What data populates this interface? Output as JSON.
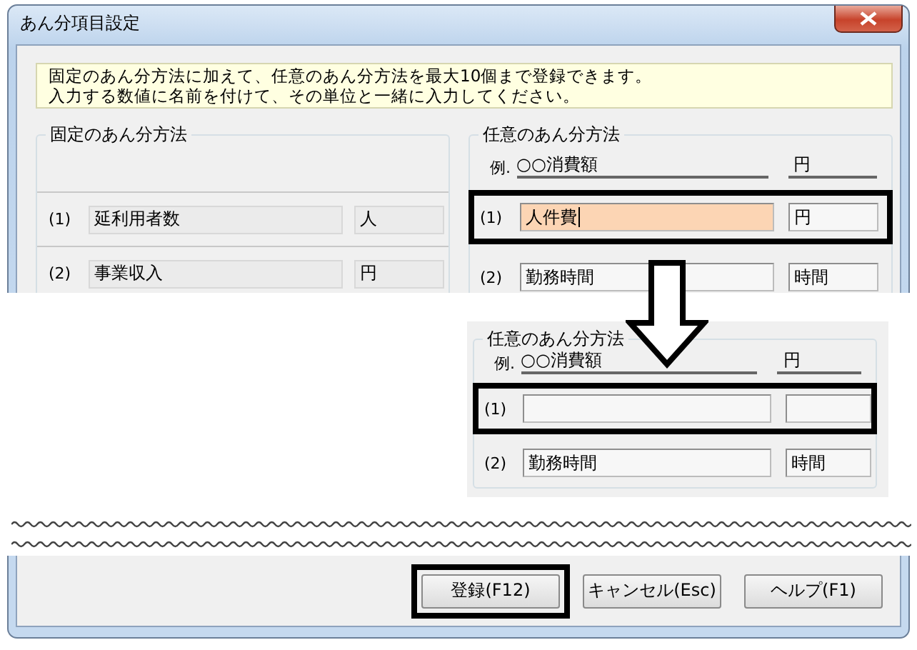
{
  "window": {
    "title": "あん分項目設定"
  },
  "notice": [
    "固定のあん分方法に加えて、任意のあん分方法を最大10個まで登録できます。",
    "入力する数値に名前を付けて、その単位と一緒に入力してください。"
  ],
  "fixed_group": {
    "title": "固定のあん分方法",
    "rows": [
      {
        "number": "(1)",
        "name": "延利用者数",
        "unit": "人"
      },
      {
        "number": "(2)",
        "name": "事業収入",
        "unit": "円"
      }
    ]
  },
  "custom_group": {
    "title": "任意のあん分方法",
    "example": {
      "prefix": "例.",
      "name": "○○消費額",
      "unit": "円"
    },
    "rows": [
      {
        "number": "(1)",
        "name": "人件費",
        "unit": "円",
        "focused": true,
        "highlighted": true
      },
      {
        "number": "(2)",
        "name": "勤務時間",
        "unit": "時間",
        "focused": false,
        "highlighted": false
      }
    ]
  },
  "inset": {
    "title": "任意のあん分方法",
    "example": {
      "prefix": "例.",
      "name": "○○消費額",
      "unit": "円"
    },
    "rows": [
      {
        "number": "(1)",
        "focused": false,
        "highlighted": true
      },
      {
        "number": "(2)",
        "name": "勤務時間",
        "unit": "時間",
        "focused": false,
        "highlighted": false
      }
    ]
  },
  "buttons": [
    {
      "label": "登録(F12)",
      "highlighted": true
    },
    {
      "label": "キャンセル(Esc)",
      "highlighted": false
    },
    {
      "label": "ヘルプ(F1)",
      "highlighted": false
    }
  ]
}
